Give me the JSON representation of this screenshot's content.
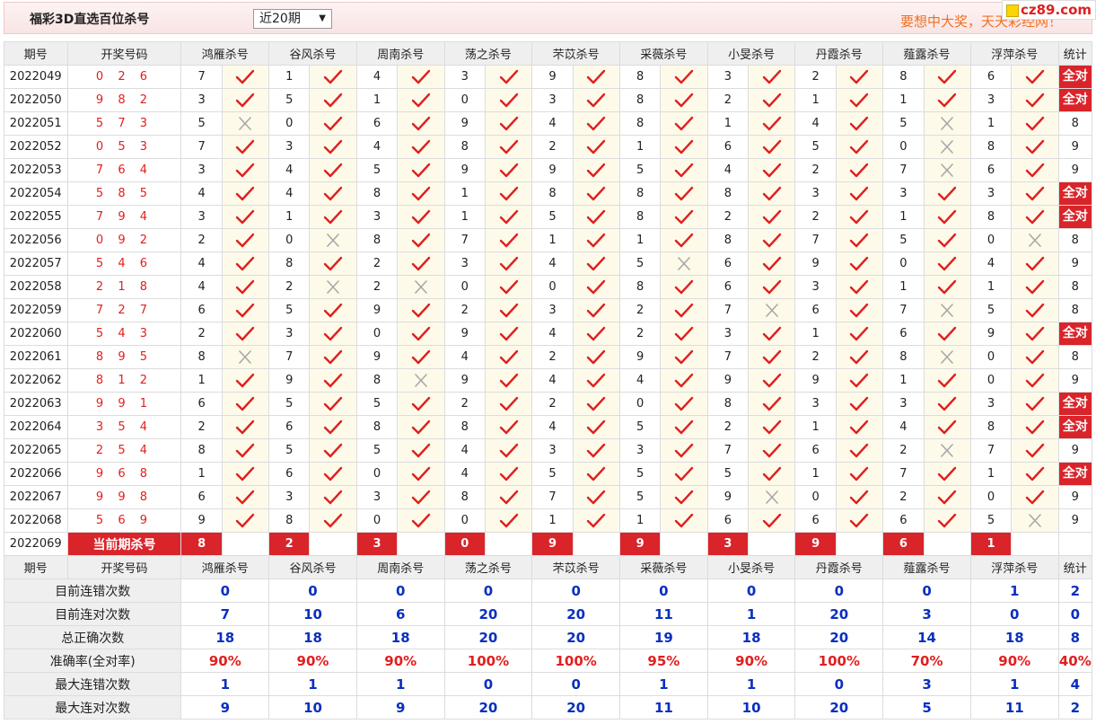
{
  "header": {
    "title": "福彩3D直选百位杀号",
    "range_select": "近20期",
    "slogan": "要想中大奖，天天彩经网！",
    "logo_text": "cz89.com"
  },
  "columns": [
    "期号",
    "开奖号码",
    "鸿雁杀号",
    "谷风杀号",
    "周南杀号",
    "荡之杀号",
    "芣苡杀号",
    "采薇杀号",
    "小旻杀号",
    "丹霞杀号",
    "薤露杀号",
    "浮萍杀号",
    "统计"
  ],
  "rows": [
    {
      "period": "2022049",
      "draw": "0 2 6",
      "kills": [
        7,
        1,
        4,
        3,
        9,
        8,
        3,
        2,
        8,
        6
      ],
      "marks": [
        1,
        1,
        1,
        1,
        1,
        1,
        1,
        1,
        1,
        1
      ],
      "stat": "全对"
    },
    {
      "period": "2022050",
      "draw": "9 8 2",
      "kills": [
        3,
        5,
        1,
        0,
        3,
        8,
        2,
        1,
        1,
        3
      ],
      "marks": [
        1,
        1,
        1,
        1,
        1,
        1,
        1,
        1,
        1,
        1
      ],
      "stat": "全对"
    },
    {
      "period": "2022051",
      "draw": "5 7 3",
      "kills": [
        5,
        0,
        6,
        9,
        4,
        8,
        1,
        4,
        5,
        1
      ],
      "marks": [
        0,
        1,
        1,
        1,
        1,
        1,
        1,
        1,
        0,
        1
      ],
      "stat": "8"
    },
    {
      "period": "2022052",
      "draw": "0 5 3",
      "kills": [
        7,
        3,
        4,
        8,
        2,
        1,
        6,
        5,
        0,
        8
      ],
      "marks": [
        1,
        1,
        1,
        1,
        1,
        1,
        1,
        1,
        0,
        1
      ],
      "stat": "9"
    },
    {
      "period": "2022053",
      "draw": "7 6 4",
      "kills": [
        3,
        4,
        5,
        9,
        9,
        5,
        4,
        2,
        7,
        6
      ],
      "marks": [
        1,
        1,
        1,
        1,
        1,
        1,
        1,
        1,
        0,
        1
      ],
      "stat": "9"
    },
    {
      "period": "2022054",
      "draw": "5 8 5",
      "kills": [
        4,
        4,
        8,
        1,
        8,
        8,
        8,
        3,
        3,
        3
      ],
      "marks": [
        1,
        1,
        1,
        1,
        1,
        1,
        1,
        1,
        1,
        1
      ],
      "stat": "全对"
    },
    {
      "period": "2022055",
      "draw": "7 9 4",
      "kills": [
        3,
        1,
        3,
        1,
        5,
        8,
        2,
        2,
        1,
        8
      ],
      "marks": [
        1,
        1,
        1,
        1,
        1,
        1,
        1,
        1,
        1,
        1
      ],
      "stat": "全对"
    },
    {
      "period": "2022056",
      "draw": "0 9 2",
      "kills": [
        2,
        0,
        8,
        7,
        1,
        1,
        8,
        7,
        5,
        0
      ],
      "marks": [
        1,
        0,
        1,
        1,
        1,
        1,
        1,
        1,
        1,
        0
      ],
      "stat": "8"
    },
    {
      "period": "2022057",
      "draw": "5 4 6",
      "kills": [
        4,
        8,
        2,
        3,
        4,
        5,
        6,
        9,
        0,
        4
      ],
      "marks": [
        1,
        1,
        1,
        1,
        1,
        0,
        1,
        1,
        1,
        1
      ],
      "stat": "9"
    },
    {
      "period": "2022058",
      "draw": "2 1 8",
      "kills": [
        4,
        2,
        2,
        0,
        0,
        8,
        6,
        3,
        1,
        1
      ],
      "marks": [
        1,
        0,
        0,
        1,
        1,
        1,
        1,
        1,
        1,
        1
      ],
      "stat": "8"
    },
    {
      "period": "2022059",
      "draw": "7 2 7",
      "kills": [
        6,
        5,
        9,
        2,
        3,
        2,
        7,
        6,
        7,
        5
      ],
      "marks": [
        1,
        1,
        1,
        1,
        1,
        1,
        0,
        1,
        0,
        1
      ],
      "stat": "8"
    },
    {
      "period": "2022060",
      "draw": "5 4 3",
      "kills": [
        2,
        3,
        0,
        9,
        4,
        2,
        3,
        1,
        6,
        9
      ],
      "marks": [
        1,
        1,
        1,
        1,
        1,
        1,
        1,
        1,
        1,
        1
      ],
      "stat": "全对"
    },
    {
      "period": "2022061",
      "draw": "8 9 5",
      "kills": [
        8,
        7,
        9,
        4,
        2,
        9,
        7,
        2,
        8,
        0
      ],
      "marks": [
        0,
        1,
        1,
        1,
        1,
        1,
        1,
        1,
        0,
        1
      ],
      "stat": "8"
    },
    {
      "period": "2022062",
      "draw": "8 1 2",
      "kills": [
        1,
        9,
        8,
        9,
        4,
        4,
        9,
        9,
        1,
        0
      ],
      "marks": [
        1,
        1,
        0,
        1,
        1,
        1,
        1,
        1,
        1,
        1
      ],
      "stat": "9"
    },
    {
      "period": "2022063",
      "draw": "9 9 1",
      "kills": [
        6,
        5,
        5,
        2,
        2,
        0,
        8,
        3,
        3,
        3
      ],
      "marks": [
        1,
        1,
        1,
        1,
        1,
        1,
        1,
        1,
        1,
        1
      ],
      "stat": "全对"
    },
    {
      "period": "2022064",
      "draw": "3 5 4",
      "kills": [
        2,
        6,
        8,
        8,
        4,
        5,
        2,
        1,
        4,
        8
      ],
      "marks": [
        1,
        1,
        1,
        1,
        1,
        1,
        1,
        1,
        1,
        1
      ],
      "stat": "全对"
    },
    {
      "period": "2022065",
      "draw": "2 5 4",
      "kills": [
        8,
        5,
        5,
        4,
        3,
        3,
        7,
        6,
        2,
        7
      ],
      "marks": [
        1,
        1,
        1,
        1,
        1,
        1,
        1,
        1,
        0,
        1
      ],
      "stat": "9"
    },
    {
      "period": "2022066",
      "draw": "9 6 8",
      "kills": [
        1,
        6,
        0,
        4,
        5,
        5,
        5,
        1,
        7,
        1
      ],
      "marks": [
        1,
        1,
        1,
        1,
        1,
        1,
        1,
        1,
        1,
        1
      ],
      "stat": "全对"
    },
    {
      "period": "2022067",
      "draw": "9 9 8",
      "kills": [
        6,
        3,
        3,
        8,
        7,
        5,
        9,
        0,
        2,
        0
      ],
      "marks": [
        1,
        1,
        1,
        1,
        1,
        1,
        0,
        1,
        1,
        1
      ],
      "stat": "9"
    },
    {
      "period": "2022068",
      "draw": "5 6 9",
      "kills": [
        9,
        8,
        0,
        0,
        1,
        1,
        6,
        6,
        6,
        5
      ],
      "marks": [
        1,
        1,
        1,
        1,
        1,
        1,
        1,
        1,
        1,
        0
      ],
      "stat": "9"
    }
  ],
  "current": {
    "period": "2022069",
    "label": "当前期杀号",
    "kills": [
      8,
      2,
      3,
      0,
      9,
      9,
      3,
      9,
      6,
      1
    ]
  },
  "summary": [
    {
      "label": "目前连错次数",
      "values": [
        "0",
        "0",
        "0",
        "0",
        "0",
        "0",
        "0",
        "0",
        "0",
        "1",
        "2"
      ],
      "red": false
    },
    {
      "label": "目前连对次数",
      "values": [
        "7",
        "10",
        "6",
        "20",
        "20",
        "11",
        "1",
        "20",
        "3",
        "0",
        "0"
      ],
      "red": false
    },
    {
      "label": "总正确次数",
      "values": [
        "18",
        "18",
        "18",
        "20",
        "20",
        "19",
        "18",
        "20",
        "14",
        "18",
        "8"
      ],
      "red": false
    },
    {
      "label": "准确率(全对率)",
      "values": [
        "90%",
        "90%",
        "90%",
        "100%",
        "100%",
        "95%",
        "90%",
        "100%",
        "70%",
        "90%",
        "40%"
      ],
      "red": true
    },
    {
      "label": "最大连错次数",
      "values": [
        "1",
        "1",
        "1",
        "0",
        "0",
        "1",
        "1",
        "0",
        "3",
        "1",
        "4"
      ],
      "red": false
    },
    {
      "label": "最大连对次数",
      "values": [
        "9",
        "10",
        "9",
        "20",
        "20",
        "11",
        "10",
        "20",
        "5",
        "11",
        "2"
      ],
      "red": false
    }
  ],
  "icons": {
    "correct": "check-icon",
    "wrong": "cross-icon",
    "correct_color": "#e0201f",
    "wrong_color": "#a8a8a8"
  }
}
